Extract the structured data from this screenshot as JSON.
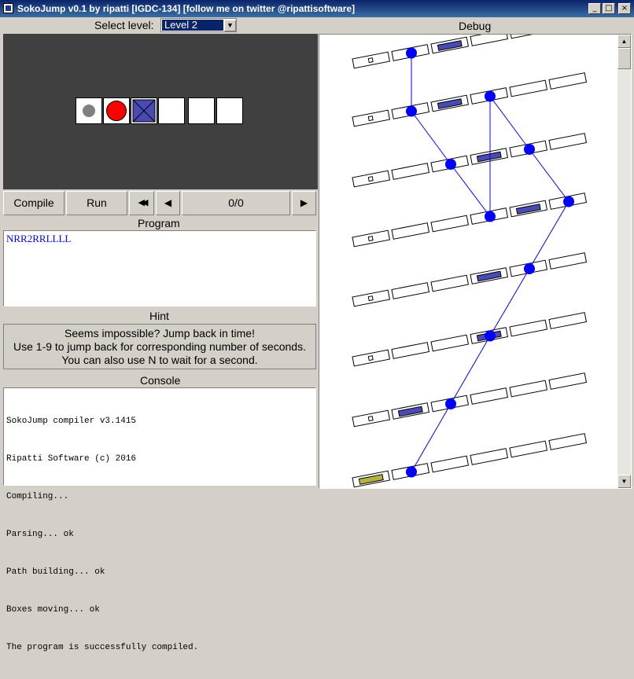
{
  "window": {
    "title": "SokoJump v0.1 by ripatti [IGDC-134] [follow me on twitter @ripattisoftware]"
  },
  "level_select": {
    "label": "Select level:",
    "value": "Level 2"
  },
  "debug": {
    "title": "Debug"
  },
  "controls": {
    "compile_label": "Compile",
    "run_label": "Run",
    "rewind_glyph": "◀◀",
    "step_back_glyph": "◀",
    "step_forward_glyph": "▶",
    "progress": "0/0"
  },
  "program": {
    "title": "Program",
    "code": "NRR2RRLLLL"
  },
  "hint": {
    "title": "Hint",
    "lines": [
      "Seems impossible? Jump back in time!",
      "Use 1-9 to jump back for corresponding number of seconds.",
      "You can also use N to wait for a second."
    ]
  },
  "console": {
    "title": "Console",
    "lines": [
      "SokoJump compiler v3.1415",
      "Ripatti Software (c) 2016",
      "Compiling...",
      "Parsing... ok",
      "Path building... ok",
      "Boxes moving... ok",
      "The program is successfully compiled."
    ]
  },
  "game_cells": [
    "grey-dot",
    "red-ball",
    "box",
    "empty",
    "empty",
    "empty"
  ],
  "colors": {
    "accent_blue": "#0000ff",
    "box_fill": "#4a4ab4",
    "goal_fill": "#b4b43c",
    "game_bg": "#404040",
    "code_blue": "#0000ff"
  },
  "icons": {
    "minimize": "_",
    "maximize": "□",
    "close": "×",
    "scroll_up": "▲",
    "scroll_down": "▼",
    "dropdown": "▼"
  }
}
